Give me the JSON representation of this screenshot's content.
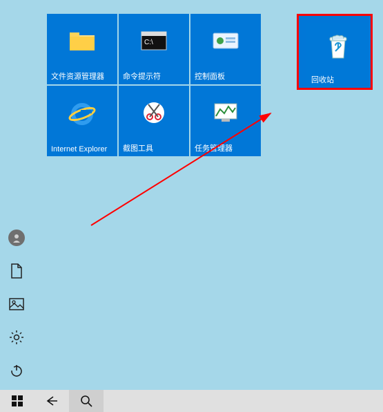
{
  "tiles": [
    {
      "label": "文件资源管理器",
      "icon": "folder"
    },
    {
      "label": "命令提示符",
      "icon": "cmd"
    },
    {
      "label": "控制面板",
      "icon": "control-panel"
    },
    {
      "label": "Internet Explorer",
      "icon": "ie"
    },
    {
      "label": "截图工具",
      "icon": "snip"
    },
    {
      "label": "任务管理器",
      "icon": "taskmgr"
    }
  ],
  "recycle": {
    "label": "回收站"
  },
  "sidebar": {
    "account": "account-icon",
    "documents": "documents-icon",
    "pictures": "pictures-icon",
    "settings": "settings-icon",
    "power": "power-icon"
  },
  "taskbar": {
    "start": "start-icon",
    "back": "back-icon",
    "search": "search-icon"
  }
}
